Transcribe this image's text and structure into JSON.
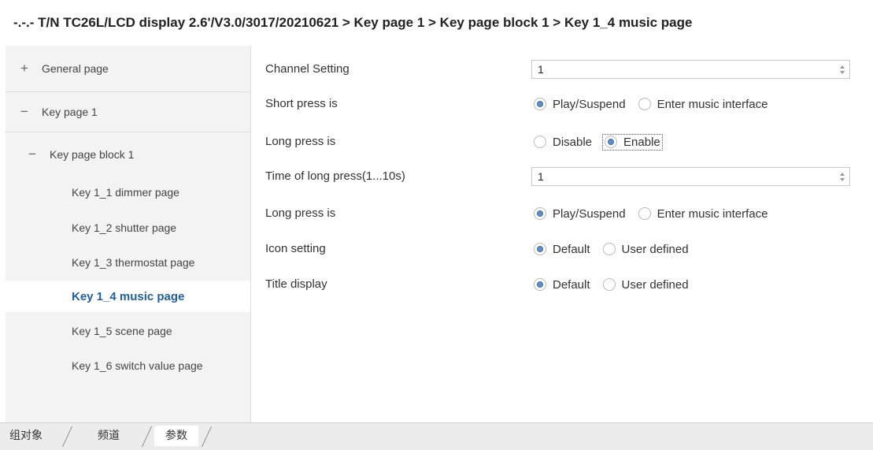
{
  "header": {
    "breadcrumb": "-.-.- T/N TC26L/LCD display 2.6'/V3.0/3017/20210621 > Key page 1 > Key page block 1 > Key 1_4 music page"
  },
  "sidebar": {
    "items": [
      {
        "symbol": "+",
        "label": "General page"
      },
      {
        "symbol": "−",
        "label": "Key page 1"
      },
      {
        "symbol": "−",
        "label": "Key page block 1"
      },
      {
        "label": "Key 1_1 dimmer page"
      },
      {
        "label": "Key 1_2 shutter page"
      },
      {
        "label": "Key 1_3 thermostat page"
      },
      {
        "label": "Key 1_4 music page",
        "selected": true
      },
      {
        "label": "Key 1_5 scene page"
      },
      {
        "label": "Key 1_6 switch value page"
      }
    ]
  },
  "params": {
    "channel_setting": {
      "label": "Channel Setting",
      "value": "1"
    },
    "short_press": {
      "label": "Short press is",
      "options": [
        "Play/Suspend",
        "Enter music interface"
      ],
      "selected": "Play/Suspend"
    },
    "long_press_enable": {
      "label": "Long press is",
      "options": [
        "Disable",
        "Enable"
      ],
      "selected": "Enable"
    },
    "long_press_time": {
      "label": "Time of long press(1...10s)",
      "value": "1"
    },
    "long_press_action": {
      "label": "Long press is",
      "options": [
        "Play/Suspend",
        "Enter music interface"
      ],
      "selected": "Play/Suspend"
    },
    "icon_setting": {
      "label": "Icon setting",
      "options": [
        "Default",
        "User defined"
      ],
      "selected": "Default"
    },
    "title_display": {
      "label": "Title display",
      "options": [
        "Default",
        "User defined"
      ],
      "selected": "Default"
    }
  },
  "footer": {
    "tabs": [
      "组对象",
      "频道",
      "参数"
    ],
    "active_tab": "参数"
  },
  "colors": {
    "selected_item": "#1f5fa0",
    "radio_dot": "#5f8fc4",
    "sidebar_bg": "#f3f3f3"
  }
}
